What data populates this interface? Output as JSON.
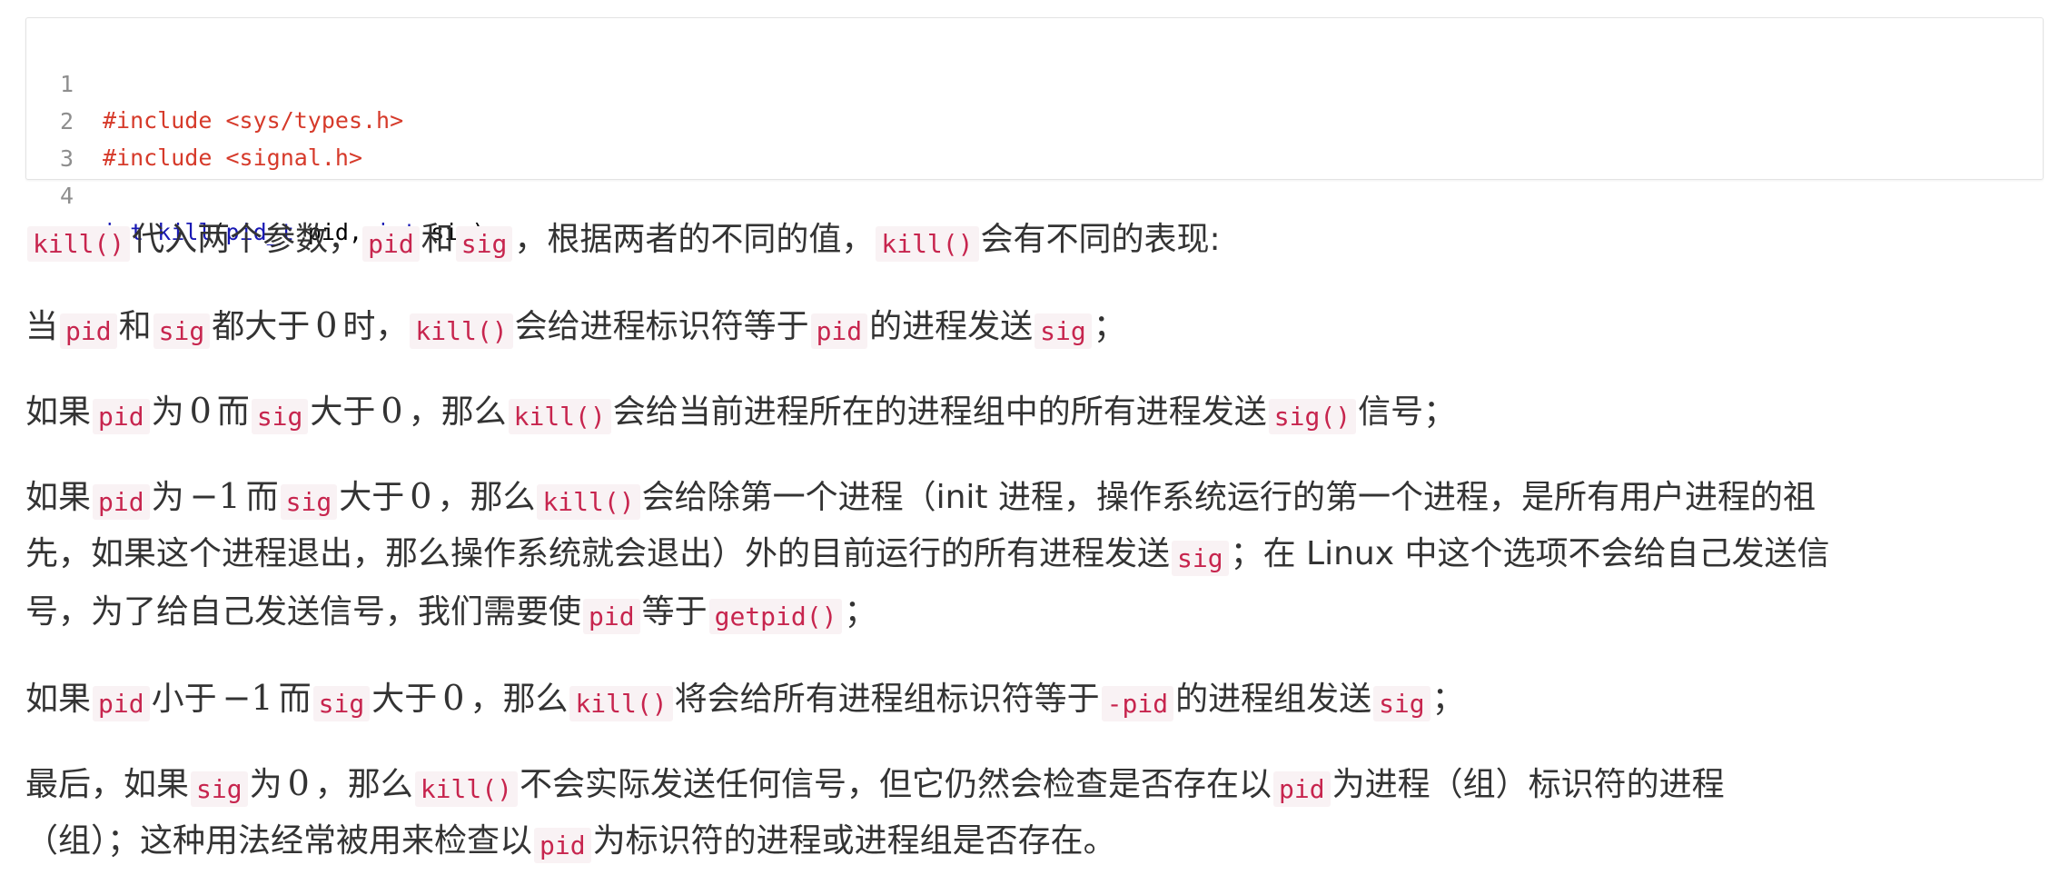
{
  "code": {
    "lines": [
      {
        "n": "1",
        "directive": "#include",
        "header": "<sys/types.h>"
      },
      {
        "n": "2",
        "directive": "#include",
        "header": "<signal.h>"
      },
      {
        "n": "3"
      },
      {
        "n": "4",
        "kw1": "int",
        "fname": "kill",
        "open": "(",
        "type": "pid_t",
        "arg1": " pid, ",
        "kw2": "int",
        "arg2": " sig);"
      }
    ]
  },
  "paragraphs": {
    "p1": {
      "c1": "kill()",
      "t1": "代入两个参数，",
      "c2": "pid",
      "t2": "和",
      "c3": "sig",
      "t3": "，根据两者的不同的值，",
      "c4": "kill()",
      "t4": "会有不同的表现:"
    },
    "p2": {
      "t0": "当",
      "c1": "pid",
      "t1": "和",
      "c2": "sig",
      "t2": "都大于",
      "n1": "0",
      "t3": "时，",
      "c3": "kill()",
      "t4": "会给进程标识符等于",
      "c4": "pid",
      "t5": "的进程发送",
      "c5": "sig",
      "t6": "；"
    },
    "p3": {
      "t0": "如果",
      "c1": "pid",
      "t1": "为",
      "n1": "0",
      "t2": "而",
      "c2": "sig",
      "t3": "大于",
      "n2": "0",
      "t4": "，那么",
      "c3": "kill()",
      "t5": "会给当前进程所在的进程组中的所有进程发送",
      "c4": "sig()",
      "t6": "信号；"
    },
    "p4": {
      "line1": {
        "t0": "如果",
        "c1": "pid",
        "t1": "为",
        "n1": "−1",
        "t2": "而",
        "c2": "sig",
        "t3": "大于",
        "n2": "0",
        "t4": "，那么",
        "c3": "kill()",
        "t5": "会给除第一个进程（init 进程，操作系统运行的第一个进程，是所有用户进程的祖"
      },
      "line2": {
        "t0": "先，如果这个进程退出，那么操作系统就会退出）外的目前运行的所有进程发送",
        "c1": "sig",
        "t1": "；在 Linux 中这个选项不会给自己发送信"
      },
      "line3": {
        "t0": "号，为了给自己发送信号，我们需要使",
        "c1": "pid",
        "t1": "等于",
        "c2": "getpid()",
        "t2": "；"
      }
    },
    "p5": {
      "t0": "如果",
      "c1": "pid",
      "t1": "小于",
      "n1": "−1",
      "t2": "而",
      "c2": "sig",
      "t3": "大于",
      "n2": "0",
      "t4": "，那么",
      "c3": "kill()",
      "t5": "将会给所有进程组标识符等于",
      "c4": "-pid",
      "t6": "的进程组发送",
      "c5": "sig",
      "t7": "；"
    },
    "p6": {
      "line1": {
        "t0": "最后，如果",
        "c1": "sig",
        "t1": "为",
        "n1": "0",
        "t2": "，那么",
        "c2": "kill()",
        "t3": "不会实际发送任何信号，但它仍然会检查是否存在以",
        "c3": "pid",
        "t4": "为进程（组）标识符的进程"
      },
      "line2": {
        "t0": "（组）；这种用法经常被用来检查以",
        "c1": "pid",
        "t1": "为标识符的进程或进程组是否存在。"
      }
    }
  }
}
